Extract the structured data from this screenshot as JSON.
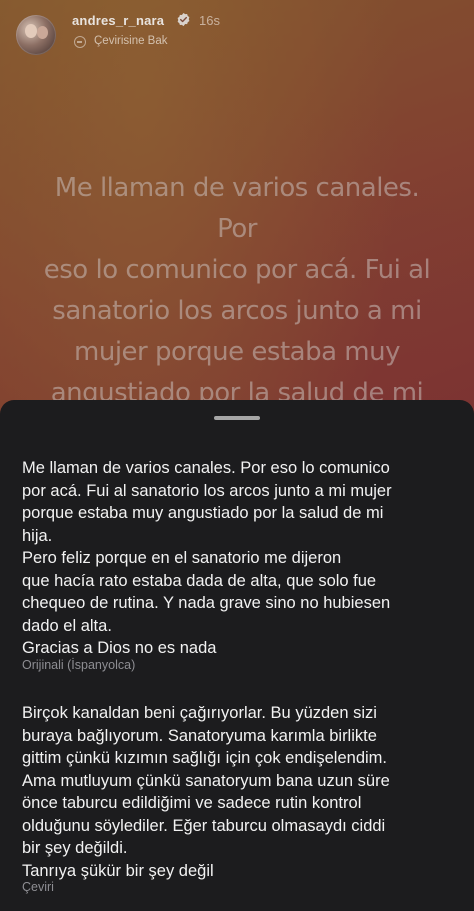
{
  "header": {
    "username": "andres_r_nara",
    "timestamp": "16s",
    "see_translation": "Çevirisine Bak"
  },
  "story": {
    "text": "Me llaman de varios canales. Por\neso lo comunico por acá. Fui al\nsanatorio los arcos junto a mi\nmujer  porque estaba muy\nangustiado por la salud de mi\nhija."
  },
  "sheet": {
    "original_text": "Me llaman de varios canales. Por eso lo comunico\npor acá. Fui al sanatorio los arcos junto a mi mujer\nporque estaba muy angustiado por la salud de mi\nhija.\nPero feliz porque en el sanatorio me dijeron\nque hacía rato estaba dada de alta, que solo fue\nchequeo de rutina. Y nada grave sino no hubiesen\ndado el alta.\nGracias a Dios no es nada",
    "original_label": "Orijinali (İspanyolca)",
    "translated_text": "Birçok kanaldan beni çağırıyorlar. Bu yüzden sizi\nburaya bağlıyorum. Sanatoryuma karımla birlikte\ngittim çünkü kızımın sağlığı için çok endişelendim.\nAma mutluyum çünkü sanatoryum bana uzun süre\nönce taburcu edildiğimi ve sadece rutin kontrol\nolduğunu söylediler. Eğer taburcu olmasaydı ciddi\nbir şey değildi.\nTanrıya şükür bir şey değil",
    "translated_label": "Çeviri"
  },
  "colors": {
    "sheet_background": "#1c1c1e",
    "verified_badge": "#3897f0",
    "sheet_text": "#f2f2f2",
    "label_text": "#8e8e93"
  },
  "icons": {
    "verified": "verified-badge-icon",
    "translate": "translate-icon"
  }
}
